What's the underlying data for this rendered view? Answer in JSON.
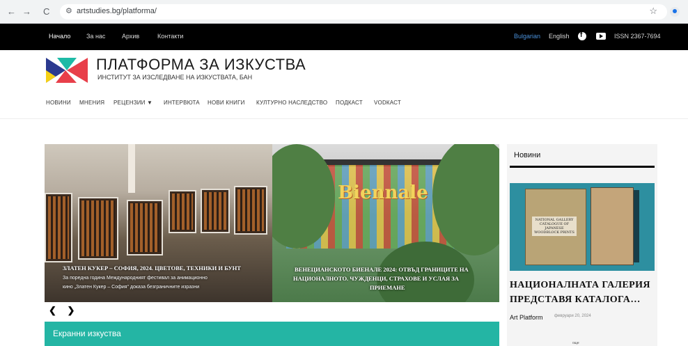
{
  "browser": {
    "back": "←",
    "forward": "→",
    "reload": "C",
    "url": "artstudies.bg/platforma/",
    "star": "☆"
  },
  "topbar": {
    "nav": [
      "Начало",
      "За нас",
      "Архив",
      "Контакти"
    ],
    "languages": [
      "Bulgarian",
      "English"
    ],
    "issn": "ISSN 2367-7694",
    "social": [
      "facebook-icon",
      "youtube-icon"
    ]
  },
  "header": {
    "title": "ПЛАТФОРМА ЗА ИЗКУСТВА",
    "subtitle": "ИНСТИТУТ ЗА ИЗСЛЕДВАНЕ НА ИЗКУСТВАТА, БАН",
    "logo_colors": [
      "#e83f4a",
      "#2b3a8f",
      "#f5d015",
      "#1ebaa6"
    ]
  },
  "menu": [
    "НОВИНИ",
    "МНЕНИЯ",
    "РЕЦЕНЗИИ ▼",
    "ИНТЕРВЮТА",
    "НОВИ КНИГИ",
    "КУЛТУРНО НАСЛЕДСТВО",
    "ПОДКАСТ",
    "VODКАСТ"
  ],
  "slider": {
    "slides": [
      {
        "title": "ЗЛАТЕН КУКЕР – СОФИЯ, 2024. ЦВЕТОВЕ, ТЕХНИКИ И БУНТ",
        "text_line1": "За поредна година Международният фестивал за анимационно",
        "text_line2": "кино „Златен Кукер – София“ доказа безграничните изразни"
      },
      {
        "title_line1": "ВЕНЕЦИАНСКОТО БИЕНАЛЕ 2024: ОТВЪД ГРАНИЦИТЕ НА",
        "title_line2": "НАЦИОНАЛНОТО. ЧУЖДЕНЦИ, СТРАХОВЕ И УСЛАЯ ЗА",
        "title_line3": "ПРИЕМАНЕ",
        "sign": "La Biennale"
      }
    ],
    "prev": "❮",
    "next": "❯"
  },
  "section_label": "Екранни изкуства",
  "sidebar": {
    "heading": "Новини",
    "book_caption": "NATIONAL GALLERY CATALOGUE OF JAPANESE WOODBLOCK PRINTS",
    "article_title_line1": "НАЦИОНАЛНАТА ГАЛЕРИЯ",
    "article_title_line2": "ПРЕДСТАВЯ КАТАЛОГА…",
    "author": "Art Platform",
    "date": "февруари 20, 2024",
    "more": "още"
  },
  "colors": {
    "topbar": "#000000",
    "teal": "#24b5a4",
    "link_blue": "#4a90d9"
  }
}
